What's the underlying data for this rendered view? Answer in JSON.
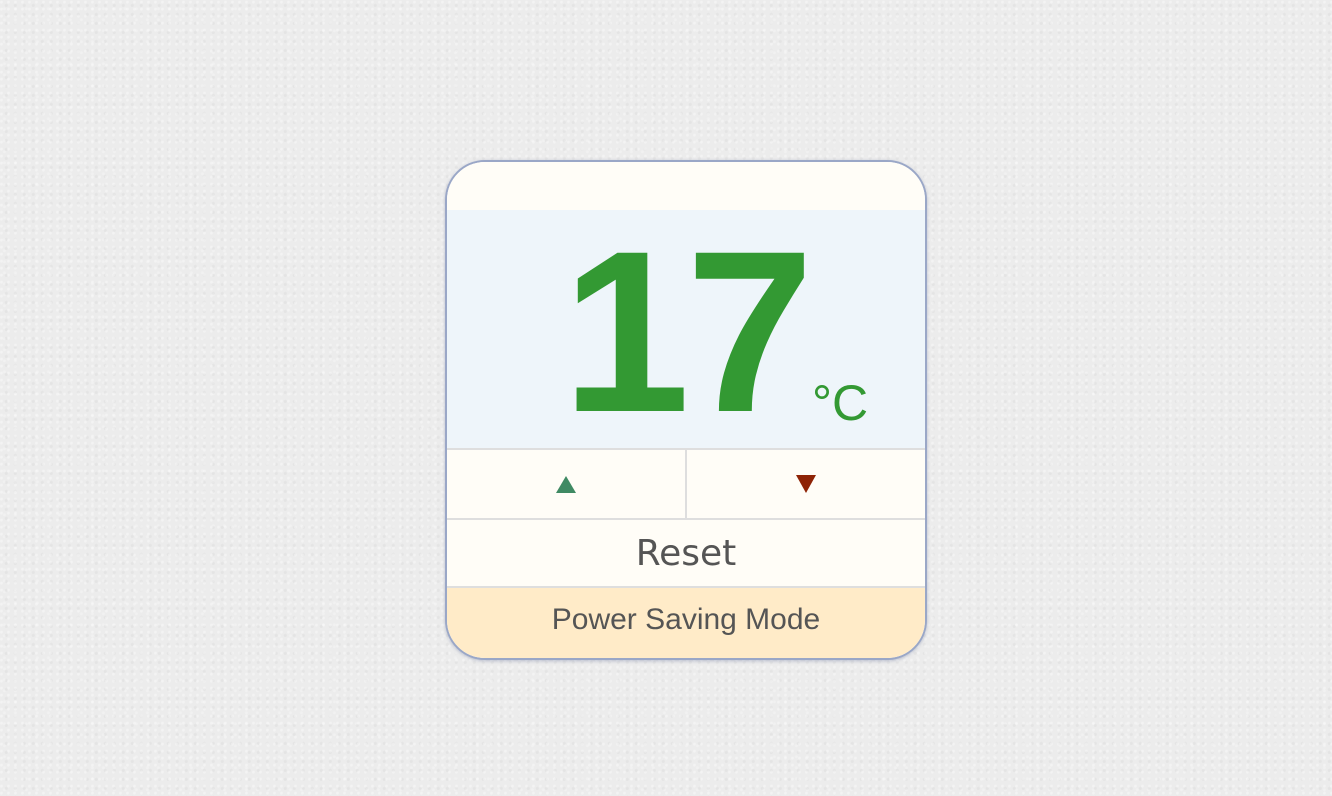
{
  "thermostat": {
    "temperature": "17",
    "unit": "°C",
    "increase_icon": "triangle-up-icon",
    "decrease_icon": "triangle-down-icon",
    "reset_label": "Reset",
    "mode_label": "Power Saving Mode"
  },
  "colors": {
    "temperature_text": "#339933",
    "increase_arrow": "#3f8a63",
    "decrease_arrow": "#8e2306",
    "display_background": "#eef5fa",
    "mode_background": "#ffebc8",
    "panel_border": "#9aa7c7"
  }
}
